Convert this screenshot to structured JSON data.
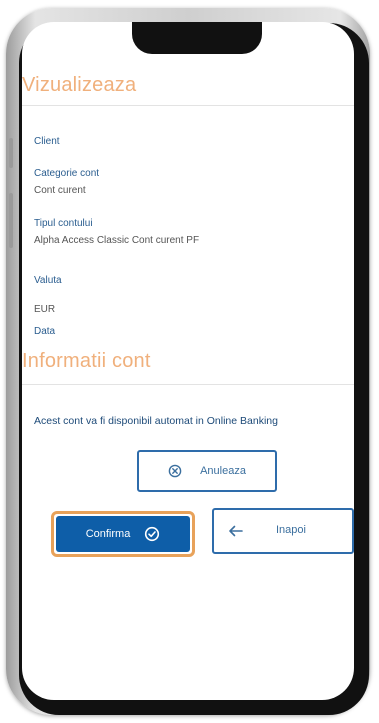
{
  "screen": {
    "view_title": "Vizualizeaza",
    "fields": [
      {
        "label": "Client",
        "value": ""
      },
      {
        "label": "Categorie cont",
        "value": "Cont curent"
      },
      {
        "label": "Tipul contului",
        "value": "Alpha Access Classic Cont curent PF"
      },
      {
        "label": "Valuta",
        "value": "EUR"
      },
      {
        "label": "Data",
        "value": ""
      }
    ],
    "info_title": "Informatii cont",
    "notice": "Acest cont va fi disponibil automat in Online Banking"
  },
  "actions": {
    "cancel_label": "Anuleaza",
    "confirm_label": "Confirma",
    "back_label": "Inapoi"
  },
  "icons": {
    "cancel": "circle-x-icon",
    "confirm": "circle-check-icon",
    "back": "arrow-left-icon"
  },
  "colors": {
    "section_title": "#f0b07c",
    "label": "#2a5d8f",
    "primary_button": "#0e5ea8",
    "focus_ring": "#e8a25a",
    "outline_button": "#2e6cab"
  }
}
